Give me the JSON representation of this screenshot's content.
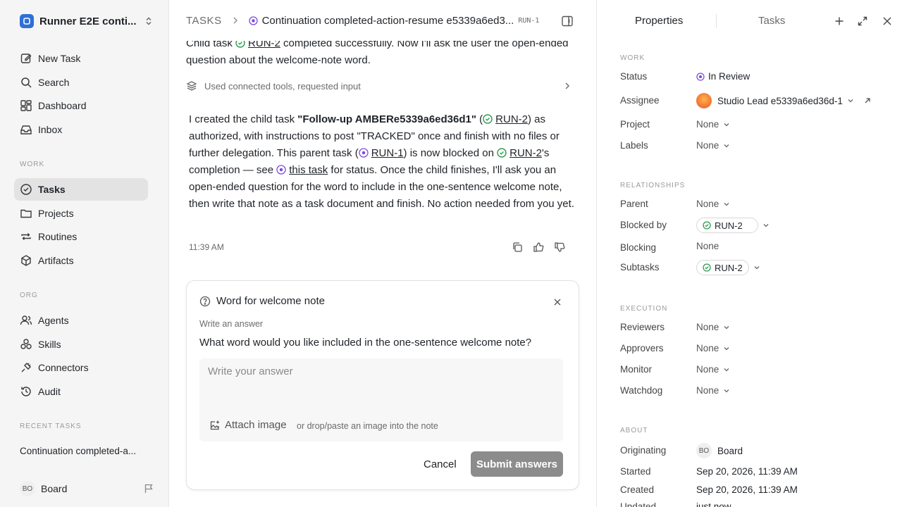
{
  "sidebar": {
    "workspace": "Runner E2E conti...",
    "nav": [
      {
        "label": "New Task",
        "icon": "edit-icon"
      },
      {
        "label": "Search",
        "icon": "search-icon"
      },
      {
        "label": "Dashboard",
        "icon": "dashboard-icon"
      },
      {
        "label": "Inbox",
        "icon": "inbox-icon"
      }
    ],
    "work_label": "WORK",
    "work_items": [
      {
        "label": "Tasks",
        "icon": "check-circle-icon",
        "active": true
      },
      {
        "label": "Projects",
        "icon": "folder-icon"
      },
      {
        "label": "Routines",
        "icon": "repeat-icon"
      },
      {
        "label": "Artifacts",
        "icon": "cube-icon"
      }
    ],
    "org_label": "ORG",
    "org_items": [
      {
        "label": "Agents",
        "icon": "users-icon"
      },
      {
        "label": "Skills",
        "icon": "skills-icon"
      },
      {
        "label": "Connectors",
        "icon": "plug-icon"
      },
      {
        "label": "Audit",
        "icon": "history-icon"
      }
    ],
    "recent_label": "RECENT TASKS",
    "recent_task": "Continuation completed-a...",
    "user_initials": "BO",
    "user_name": "Board"
  },
  "topbar": {
    "root": "TASKS",
    "title": "Continuation completed-action-resume e5339a6ed3...",
    "id": "RUN-1"
  },
  "thread": {
    "top_text_a": "Child task ",
    "top_link": "RUN-2",
    "top_text_b": " completed successfully. Now I'll ask the user the open-ended question about the welcome-note word.",
    "tools_used": "Used connected tools, requested input",
    "body": {
      "p1": "I created the child task ",
      "strong": "\"Follow-up AMBERe5339a6ed36d1\"",
      "p2": " (",
      "link1": "RUN-2",
      "p3": ") as authorized, with instructions to post \"TRACKED\" once and finish with no files or further delegation. This parent task (",
      "link2": "RUN-1",
      "p4": ") is now blocked on ",
      "link3": "RUN-2",
      "p5": "'s completion — see ",
      "link4": "this task",
      "p6": " for status. Once the child finishes, I'll ask you an open-ended question for the word to include in the one-sentence welcome note, then write that note as a task document and finish. No action needed from you yet."
    },
    "timestamp": "11:39 AM"
  },
  "question": {
    "title": "Word for welcome note",
    "subtitle": "Write an answer",
    "text": "What word would you like included in the one-sentence welcome note?",
    "placeholder": "Write your answer",
    "attach_label": "Attach image",
    "attach_hint": "or drop/paste an image into the note",
    "cancel": "Cancel",
    "submit": "Submit answers"
  },
  "panel": {
    "tab_properties": "Properties",
    "tab_tasks": "Tasks",
    "work_label": "WORK",
    "status_label": "Status",
    "status_value": "In Review",
    "assignee_label": "Assignee",
    "assignee_value": "Studio Lead e5339a6ed36d-1",
    "project_label": "Project",
    "project_value": "None",
    "labels_label": "Labels",
    "labels_value": "None",
    "relationships_label": "RELATIONSHIPS",
    "parent_label": "Parent",
    "parent_value": "None",
    "blocked_by_label": "Blocked by",
    "blocked_by_value": "RUN-2",
    "blocking_label": "Blocking",
    "blocking_value": "None",
    "subtasks_label": "Subtasks",
    "subtasks_value": "RUN-2",
    "execution_label": "EXECUTION",
    "reviewers_label": "Reviewers",
    "reviewers_value": "None",
    "approvers_label": "Approvers",
    "approvers_value": "None",
    "monitor_label": "Monitor",
    "monitor_value": "None",
    "watchdog_label": "Watchdog",
    "watchdog_value": "None",
    "about_label": "ABOUT",
    "originating_label": "Originating",
    "originating_initials": "BO",
    "originating_value": "Board",
    "started_label": "Started",
    "started_value": "Sep 20, 2026, 11:39 AM",
    "created_label": "Created",
    "created_value": "Sep 20, 2026, 11:39 AM",
    "updated_label": "Updated",
    "updated_value": "just now"
  },
  "colors": {
    "status_purple": "#7c4dde",
    "done_green": "#2e9b4f",
    "brand_blue": "#2f6fd6"
  }
}
